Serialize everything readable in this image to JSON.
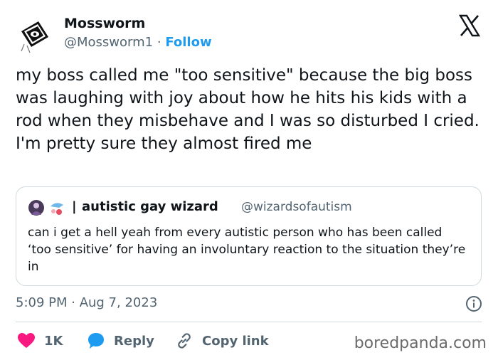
{
  "author": {
    "name": "Mossworm",
    "handle": "@Mossworm1",
    "separator": "·",
    "follow_label": "Follow"
  },
  "tweet": {
    "text": "my boss called me \"too sensitive\" because the big boss was laughing with joy about how he hits his kids with a rod when they misbehave and I was so disturbed I cried. I'm pretty sure they almost fired me"
  },
  "quote": {
    "pipe": "|",
    "name": "autistic gay wizard",
    "handle": "@wizardsofautism",
    "text": "can i get a hell yeah from every autistic person who has been called ‘too sensitive’ for having an involuntary reaction to the situation they’re in"
  },
  "meta": {
    "timestamp": "5:09 PM · Aug 7, 2023"
  },
  "actions": {
    "like_count": "1K",
    "reply_label": "Reply",
    "copy_label": "Copy link"
  },
  "watermark": "boredpanda.com",
  "colors": {
    "accent": "#1d9bf0",
    "like": "#f91880",
    "secondary_text": "#536471",
    "border": "#cfd9de"
  },
  "icons": {
    "platform": "x-logo-icon",
    "info": "info-icon",
    "like": "heart-icon",
    "reply": "speech-bubble-icon",
    "copy": "link-icon"
  }
}
